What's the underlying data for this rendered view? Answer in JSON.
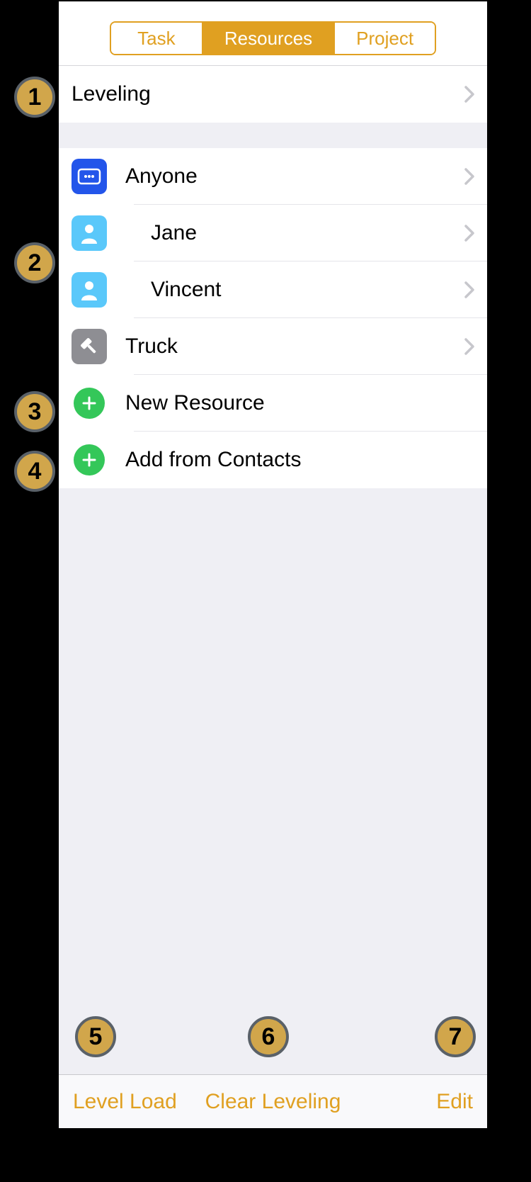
{
  "tabs": {
    "task": "Task",
    "resources": "Resources",
    "project": "Project"
  },
  "leveling_row": "Leveling",
  "resources": {
    "group": "Anyone",
    "person1": "Jane",
    "person2": "Vincent",
    "equipment": "Truck"
  },
  "actions": {
    "new_resource": "New Resource",
    "add_from_contacts": "Add from Contacts"
  },
  "toolbar": {
    "level_load": "Level Load",
    "clear_leveling": "Clear Leveling",
    "edit": "Edit"
  },
  "callouts": {
    "c1": "1",
    "c2": "2",
    "c3": "3",
    "c4": "4",
    "c5": "5",
    "c6": "6",
    "c7": "7"
  }
}
